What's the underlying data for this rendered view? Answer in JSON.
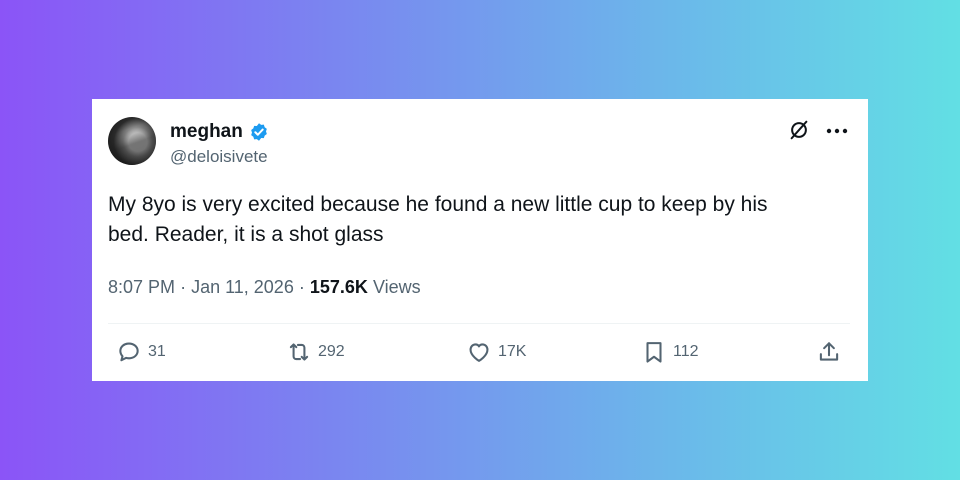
{
  "tweet": {
    "display_name": "meghan",
    "handle": "@deloisivete",
    "text_line1": "My 8yo is very excited because he found a new little cup to keep by his",
    "text_line2": "bed. Reader, it is a shot glass",
    "time": "8:07 PM",
    "date": "Jan 11, 2026",
    "separator": "·",
    "views_count": "157.6K",
    "views_label": "Views",
    "verified": true,
    "colors": {
      "verified_badge": "#1d9bf0",
      "text_primary": "#0f1419",
      "text_secondary": "#536471",
      "gradient_start": "#8b54f7",
      "gradient_end": "#62dfe4"
    }
  },
  "actions": {
    "reply": {
      "icon": "reply-icon",
      "count": "31"
    },
    "retweet": {
      "icon": "retweet-icon",
      "count": "292"
    },
    "like": {
      "icon": "heart-icon",
      "count": "17K"
    },
    "bookmark": {
      "icon": "bookmark-icon",
      "count": "112"
    },
    "share": {
      "icon": "share-icon"
    }
  },
  "header_icons": {
    "grok": "grok-icon",
    "more": "more-icon"
  }
}
